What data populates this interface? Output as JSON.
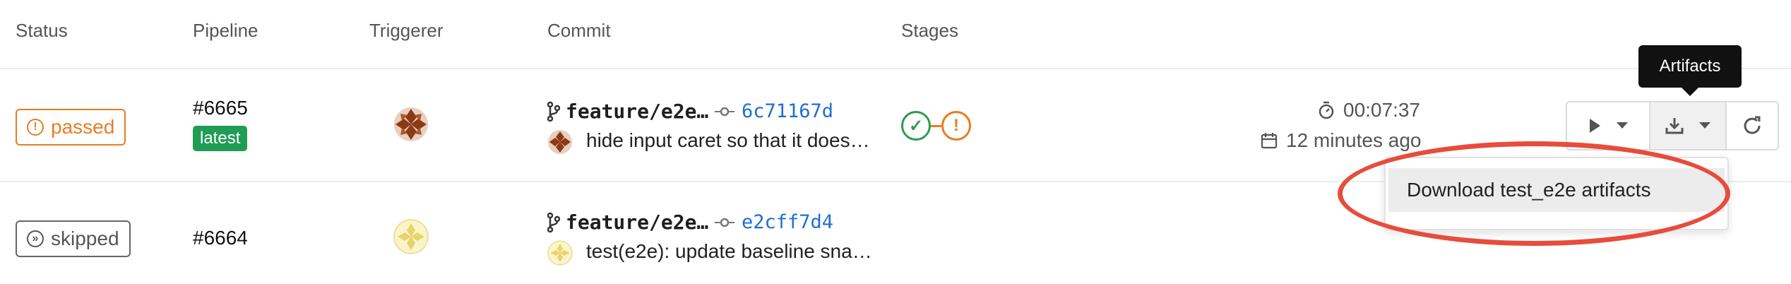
{
  "table": {
    "headers": [
      "Status",
      "Pipeline",
      "Triggerer",
      "Commit",
      "Stages"
    ]
  },
  "rows": [
    {
      "status": "passed",
      "status_icon": "!",
      "pipeline": "#6665",
      "badge": "latest",
      "branch": "feature/e2e…",
      "sha": "6c71167d",
      "message": "hide input caret so that it does…",
      "stages": [
        "success",
        "warning"
      ],
      "duration": "00:07:37",
      "finished": "12 minutes ago"
    },
    {
      "status": "skipped",
      "status_icon": "»",
      "pipeline": "#6664",
      "branch": "feature/e2e…",
      "sha": "e2cff7d4",
      "message": "test(e2e): update baseline sna…"
    }
  ],
  "tooltip": "Artifacts",
  "artifacts_menu": {
    "items": [
      "Download test_e2e artifacts"
    ]
  },
  "icons": {
    "play": "play-icon",
    "download": "download-icon",
    "retry": "retry-icon",
    "caret": "chevron-down-icon"
  },
  "colors": {
    "passed": "#e67e22",
    "success": "#2e9b4f",
    "link": "#1f6fd0",
    "latest": "#1f9d55",
    "annotation": "#e74c3c"
  }
}
